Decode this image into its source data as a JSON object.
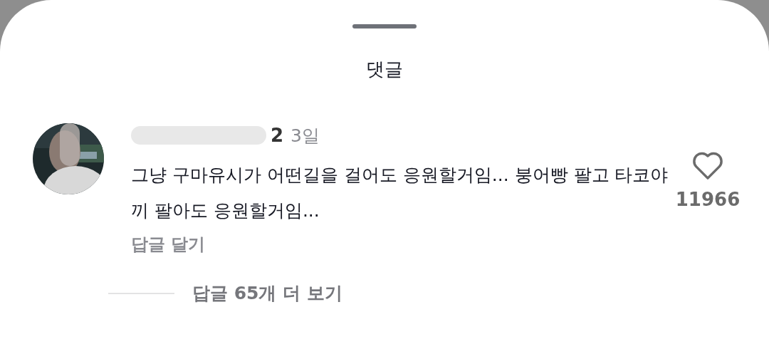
{
  "sheet": {
    "title": "댓글"
  },
  "comment": {
    "username": "2",
    "time": "3일",
    "text": "그냥 구마유시가 어떤길을 걸어도 응원할거임... 붕어빵 팔고 타코야끼 팔아도 응원할거임...",
    "reply_label": "답글 달기",
    "liked": false,
    "likes": "11966"
  },
  "more_replies": "답글 65개 더 보기"
}
